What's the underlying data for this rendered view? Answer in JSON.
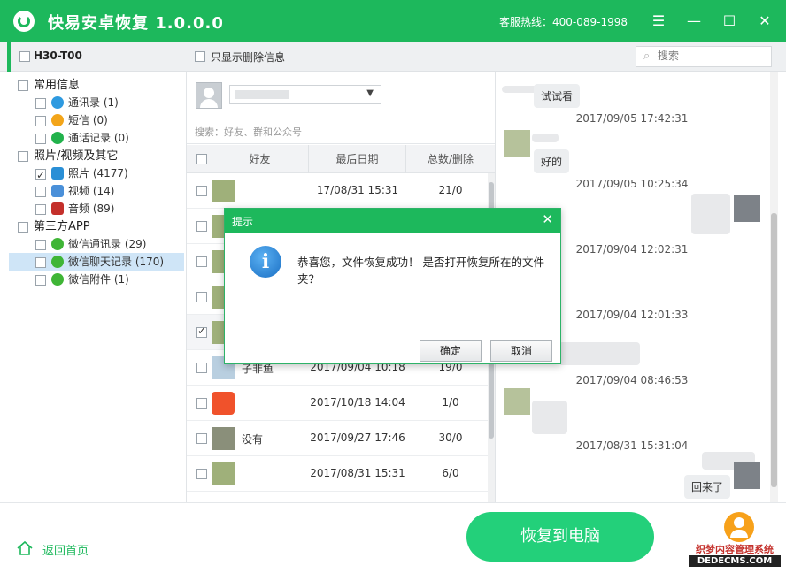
{
  "app": {
    "title": "快易安卓恢复  1.0.0.0",
    "hotline": "客服热线：400-089-1998",
    "window_controls": [
      "menu-icon",
      "minimize-icon",
      "maximize-icon",
      "close-icon"
    ]
  },
  "toolbar": {
    "device_name": "H30-T00",
    "show_deleted_label": "只显示删除信息",
    "search_placeholder": "搜索"
  },
  "sidebar": {
    "groups": [
      {
        "label": "常用信息",
        "items": [
          {
            "label": "通讯录 (1)",
            "icon": "contacts-icon"
          },
          {
            "label": "短信 (0)",
            "icon": "sms-icon"
          },
          {
            "label": "通话记录 (0)",
            "icon": "call-log-icon"
          }
        ]
      },
      {
        "label": "照片/视频及其它",
        "items": [
          {
            "label": "照片 (4177)",
            "icon": "photo-icon",
            "checked": true
          },
          {
            "label": "视频 (14)",
            "icon": "video-icon"
          },
          {
            "label": "音频 (89)",
            "icon": "audio-icon"
          }
        ]
      },
      {
        "label": "第三方APP",
        "items": [
          {
            "label": "微信通讯录 (29)",
            "icon": "wechat-icon"
          },
          {
            "label": "微信聊天记录 (170)",
            "icon": "wechat-icon",
            "selected": true
          },
          {
            "label": "微信附件 (1)",
            "icon": "wechat-icon"
          }
        ]
      }
    ]
  },
  "chat_list": {
    "search_hint": "搜索：好友、群和公众号",
    "columns": [
      "好友",
      "最后日期",
      "总数/删除"
    ],
    "rows": [
      {
        "name": "",
        "date": "17/08/31 15:31",
        "count": "21/0"
      },
      {
        "name": "",
        "date": "",
        "count": ""
      },
      {
        "name": "",
        "date": "",
        "count": ""
      },
      {
        "name": "",
        "date": "",
        "count": ""
      },
      {
        "name": "",
        "date": "",
        "count": "",
        "checked": true
      },
      {
        "name": "子非鱼",
        "date": "2017/09/04 10:18",
        "count": "19/0"
      },
      {
        "name": "",
        "date": "2017/10/18 14:04",
        "count": "1/0"
      },
      {
        "name": "没有",
        "date": "2017/09/27 17:46",
        "count": "30/0"
      },
      {
        "name": "",
        "date": "2017/08/31 15:31",
        "count": "6/0"
      }
    ]
  },
  "chat": {
    "messages": [
      {
        "text": "试试看"
      },
      {
        "time": "2017/09/05 17:42:31"
      },
      {
        "text": "好的"
      },
      {
        "time": "2017/09/05 10:25:34"
      },
      {
        "time": "2017/09/04 12:02:31"
      },
      {
        "time": "2017/09/04 12:01:33"
      },
      {
        "time": "2017/09/04 08:46:53"
      },
      {
        "time": "2017/08/31 15:31:04"
      },
      {
        "text": "回来了"
      }
    ]
  },
  "bottom": {
    "home_label": "返回首页",
    "restore_label": "恢复到电脑",
    "watermark_top": "织梦内容管理系统",
    "watermark_url": "DEDECMS.COM"
  },
  "dialog": {
    "title": "提示",
    "message": "恭喜您，文件恢复成功！ 是否打开恢复所在的文件夹？",
    "ok_label": "确定",
    "cancel_label": "取消"
  },
  "colors": {
    "brand_green": "#1db85c",
    "button_green": "#23d07a",
    "selection_blue": "#cfe5f7"
  }
}
